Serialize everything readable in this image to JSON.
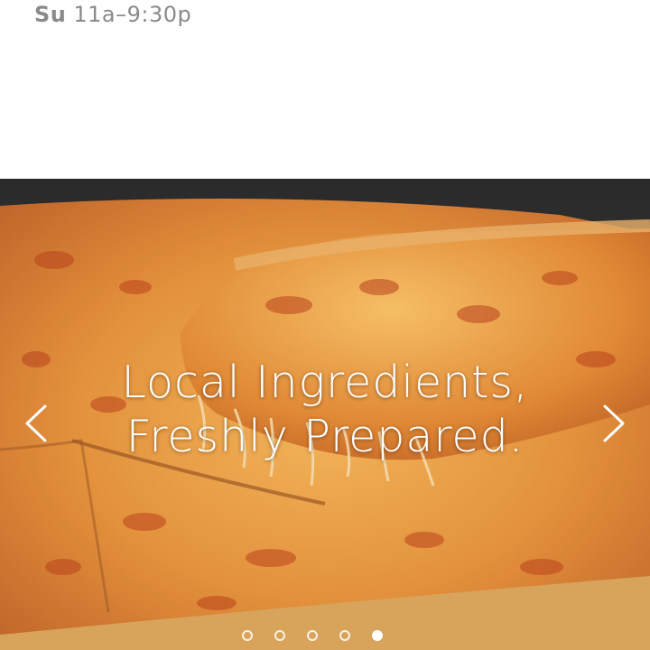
{
  "hours": {
    "day": "Su",
    "time": "11a–9:30p"
  },
  "slider": {
    "image": "pizza-slice-photo",
    "caption_line1": "Local Ingredients,",
    "caption_line2": "Freshly Prepared.",
    "prev_icon": "chevron-left-icon",
    "next_icon": "chevron-right-icon",
    "dot_count": 5,
    "active_dot": 5
  },
  "colors": {
    "hours_text": "#8a8a8a",
    "caption": "#ffffff",
    "cheese": "#e0903a",
    "sauce": "#b9421c"
  }
}
